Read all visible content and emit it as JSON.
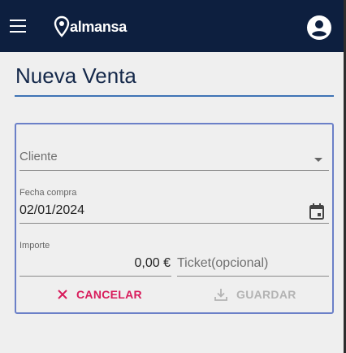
{
  "header": {
    "logo_text": "almansa",
    "menu_icon": "menu-icon",
    "account_icon": "account-circle-icon"
  },
  "page": {
    "title": "Nueva Venta"
  },
  "form": {
    "cliente": {
      "label": "Cliente",
      "icon": "dropdown-arrow-icon"
    },
    "fecha_compra": {
      "label": "Fecha compra",
      "value": "02/01/2024",
      "icon": "calendar-icon"
    },
    "importe": {
      "label": "Importe",
      "value": "0,00 €"
    },
    "ticket": {
      "placeholder": "Ticket(opcional)"
    }
  },
  "actions": {
    "cancel_label": "CANCELAR",
    "cancel_icon": "close-icon",
    "save_label": "GUARDAR",
    "save_icon": "download-icon"
  },
  "colors": {
    "topbar": "#0d1f3f",
    "title": "#14284a",
    "accent_line": "#3f73b5",
    "card_border": "#6b80c8",
    "cancel": "#d81b5b",
    "disabled": "#b3b3b3",
    "background": "#efefef"
  }
}
